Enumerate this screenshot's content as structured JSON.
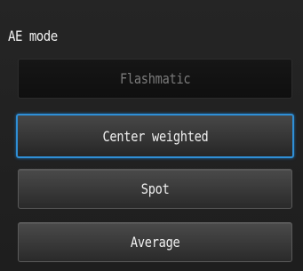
{
  "dialog": {
    "title": "AE mode"
  },
  "options": [
    {
      "label": "Flashmatic",
      "state": "disabled"
    },
    {
      "label": "Center weighted",
      "state": "selected"
    },
    {
      "label": "Spot",
      "state": "normal"
    },
    {
      "label": "Average",
      "state": "normal"
    }
  ],
  "colors": {
    "selection_border": "#2f8fd6",
    "disabled_text": "#7a7a7a",
    "text": "#f2f2f2"
  }
}
